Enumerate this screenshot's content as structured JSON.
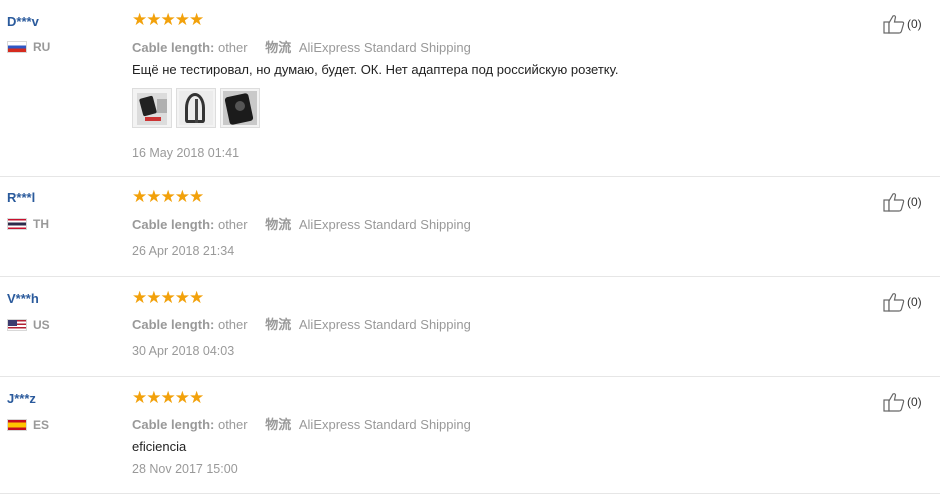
{
  "reviews": [
    {
      "user": "D***v",
      "country": "RU",
      "rating_stars": "★★★★★",
      "rating": 5,
      "cable_length_label": "Cable length:",
      "cable_length_value": "other",
      "shipping_label": "物流",
      "shipping_value": "AliExpress Standard Shipping",
      "feedback": "Ещё не тестировал, но думаю, будет. ОК. Нет адаптера под российскую розетку.",
      "photos": [
        "photo-1",
        "photo-2",
        "photo-3"
      ],
      "date": "16 May 2018 01:41",
      "useful_count": "(0)"
    },
    {
      "user": "R***l",
      "country": "TH",
      "rating_stars": "★★★★★",
      "rating": 5,
      "cable_length_label": "Cable length:",
      "cable_length_value": "other",
      "shipping_label": "物流",
      "shipping_value": "AliExpress Standard Shipping",
      "date": "26 Apr 2018 21:34",
      "useful_count": "(0)"
    },
    {
      "user": "V***h",
      "country": "US",
      "rating_stars": "★★★★★",
      "rating": 5,
      "cable_length_label": "Cable length:",
      "cable_length_value": "other",
      "shipping_label": "物流",
      "shipping_value": "AliExpress Standard Shipping",
      "date": "30 Apr 2018 04:03",
      "useful_count": "(0)"
    },
    {
      "user": "J***z",
      "country": "ES",
      "rating_stars": "★★★★★",
      "rating": 5,
      "cable_length_label": "Cable length:",
      "cable_length_value": "other",
      "shipping_label": "物流",
      "shipping_value": "AliExpress Standard Shipping",
      "feedback": "eficiencia",
      "date": "28 Nov 2017 15:00",
      "useful_count": "(0)"
    }
  ],
  "colors": {
    "star": "#f2a10b",
    "username": "#2a5a9c",
    "muted": "#999999"
  }
}
